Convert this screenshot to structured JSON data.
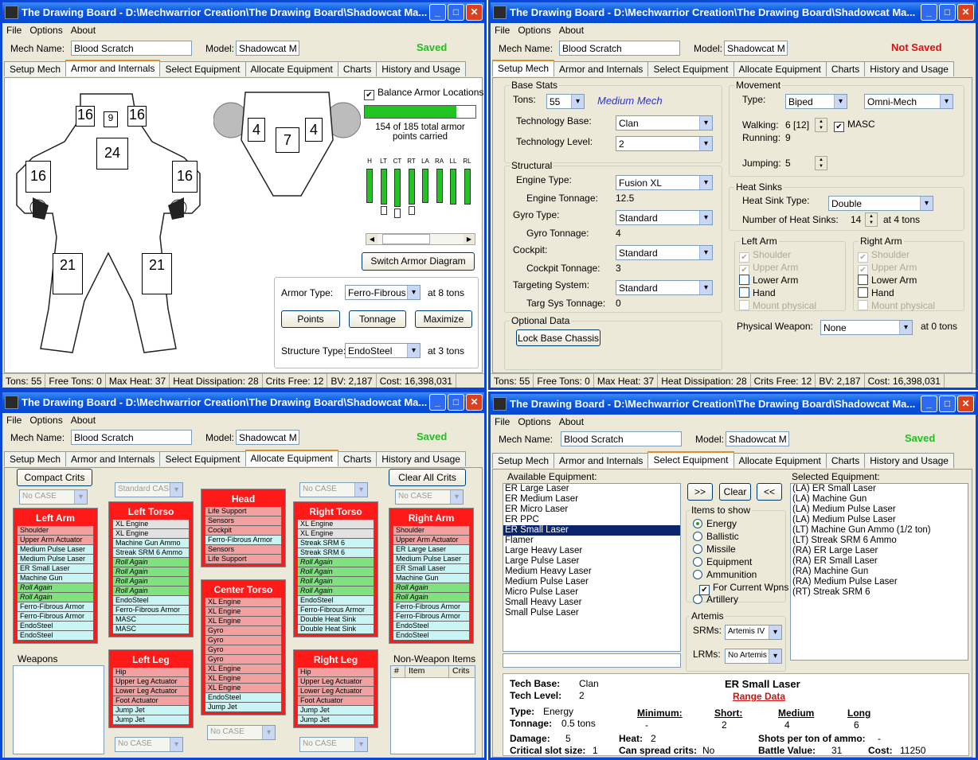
{
  "app": {
    "title": "The Drawing Board - D:\\Mechwarrior Creation\\The Drawing Board\\Shadowcat Ma...",
    "menu": [
      "File",
      "Options",
      "About"
    ],
    "tabs": [
      "Setup Mech",
      "Armor and Internals",
      "Select Equipment",
      "Allocate Equipment",
      "Charts",
      "History and Usage"
    ],
    "mech_name_label": "Mech Name:",
    "mech_name": "Blood Scratch",
    "model_label": "Model:",
    "model": "Shadowcat M",
    "saved": "Saved",
    "not_saved": "Not Saved"
  },
  "status": [
    "Tons: 55",
    "Free Tons: 0",
    "Max Heat: 37",
    "Heat Dissipation: 28",
    "Crits Free: 12",
    "BV: 2,187",
    "Cost: 16,398,031"
  ],
  "armor": {
    "rear": {
      "lt": "4",
      "ct": "7",
      "rt": "4"
    },
    "front": {
      "hd": "9",
      "ltu": "16",
      "rtu": "16",
      "ct": "24",
      "la": "16",
      "ra": "16",
      "ll": "21",
      "rl": "21"
    },
    "balance_label": "Balance Armor Locations",
    "progress": 0.83,
    "points_text": "154 of 185 total armor points carried",
    "bar_labels": [
      "H",
      "LT",
      "CT",
      "RT",
      "LA",
      "RA",
      "LL",
      "RL"
    ],
    "bars": [
      {
        "front": 0.85,
        "rear": 0
      },
      {
        "front": 0.9,
        "rear": 0.35
      },
      {
        "front": 0.95,
        "rear": 0.4
      },
      {
        "front": 0.9,
        "rear": 0.35
      },
      {
        "front": 0.85,
        "rear": 0
      },
      {
        "front": 0.85,
        "rear": 0
      },
      {
        "front": 0.9,
        "rear": 0
      },
      {
        "front": 0.9,
        "rear": 0
      }
    ],
    "switch_btn": "Switch Armor Diagram",
    "armor_type_label": "Armor Type:",
    "armor_type": "Ferro-Fibrous",
    "armor_tons": "at 8 tons",
    "points_btn": "Points",
    "tonnage_btn": "Tonnage",
    "maximize_btn": "Maximize",
    "structure_label": "Structure Type:",
    "structure": "EndoSteel",
    "structure_tons": "at 3 tons"
  },
  "setup": {
    "base_stats": "Base Stats",
    "tons_label": "Tons:",
    "tons": "55",
    "weight_class": "Medium Mech",
    "tech_base_label": "Technology Base:",
    "tech_base": "Clan",
    "tech_level_label": "Technology Level:",
    "tech_level": "2",
    "structural": "Structural",
    "engine_type_label": "Engine Type:",
    "engine_type": "Fusion XL",
    "engine_tonnage_label": "Engine Tonnage:",
    "engine_tonnage": "12.5",
    "gyro_label": "Gyro Type:",
    "gyro": "Standard",
    "gyro_tonnage_label": "Gyro Tonnage:",
    "gyro_tonnage": "4",
    "cockpit_label": "Cockpit:",
    "cockpit": "Standard",
    "cockpit_tonnage_label": "Cockpit Tonnage:",
    "cockpit_tonnage": "3",
    "targeting_label": "Targeting System:",
    "targeting": "Standard",
    "targ_tonnage_label": "Targ Sys Tonnage:",
    "targ_tonnage": "0",
    "optional": "Optional Data",
    "lock_btn": "Lock Base Chassis",
    "movement": "Movement",
    "type_label": "Type:",
    "type": "Biped",
    "omni": "Omni-Mech",
    "walking_label": "Walking:",
    "walking": "6 [12]",
    "masc": "MASC",
    "running_label": "Running:",
    "running": "9",
    "jumping_label": "Jumping:",
    "jumping": "5",
    "heat_sinks": "Heat Sinks",
    "hs_type_label": "Heat Sink Type:",
    "hs_type": "Double",
    "hs_num_label": "Number of Heat Sinks:",
    "hs_num": "14",
    "hs_tons": "at 4 tons",
    "left_arm": "Left Arm",
    "right_arm": "Right Arm",
    "arm_items": [
      "Shoulder",
      "Upper Arm",
      "Lower Arm",
      "Hand",
      "Mount physical"
    ],
    "physical_label": "Physical Weapon:",
    "physical": "None",
    "physical_tons": "at 0 tons"
  },
  "alloc": {
    "compact_btn": "Compact Crits",
    "clear_btn": "Clear All Crits",
    "no_case": "No CASE",
    "standard_case": "Standard CASE",
    "weapons": "Weapons",
    "nonweapon": "Non-Weapon Items",
    "col_num": "#",
    "col_item": "Item",
    "col_crits": "Crits",
    "locations": {
      "left_arm": {
        "title": "Left Arm",
        "slots": [
          "Shoulder",
          "Upper Arm Actuator",
          "Medium Pulse Laser",
          "Medium Pulse Laser",
          "ER Small Laser",
          "Machine Gun",
          "Roll Again",
          "Roll Again",
          "Ferro-Fibrous Armor",
          "Ferro-Fibrous Armor",
          "EndoSteel",
          "EndoSteel"
        ]
      },
      "left_torso": {
        "title": "Left Torso",
        "slots": [
          "XL Engine",
          "XL Engine",
          "Machine Gun Ammo",
          "Streak SRM 6 Ammo",
          "Roll Again",
          "Roll Again",
          "Roll Again",
          "Roll Again",
          "EndoSteel",
          "Ferro-Fibrous Armor",
          "MASC",
          "MASC"
        ]
      },
      "head": {
        "title": "Head",
        "slots": [
          "Life Support",
          "Sensors",
          "Cockpit",
          "Ferro-Fibrous Armor",
          "Sensors",
          "Life Support"
        ]
      },
      "center_torso": {
        "title": "Center Torso",
        "slots": [
          "XL Engine",
          "XL Engine",
          "XL Engine",
          "Gyro",
          "Gyro",
          "Gyro",
          "Gyro",
          "XL Engine",
          "XL Engine",
          "XL Engine",
          "EndoSteel",
          "Jump Jet"
        ]
      },
      "right_torso": {
        "title": "Right Torso",
        "slots": [
          "XL Engine",
          "XL Engine",
          "Streak SRM 6",
          "Streak SRM 6",
          "Roll Again",
          "Roll Again",
          "Roll Again",
          "Roll Again",
          "EndoSteel",
          "Ferro-Fibrous Armor",
          "Double Heat Sink",
          "Double Heat Sink"
        ]
      },
      "right_arm": {
        "title": "Right Arm",
        "slots": [
          "Shoulder",
          "Upper Arm Actuator",
          "ER Large Laser",
          "Medium Pulse Laser",
          "ER Small Laser",
          "Machine Gun",
          "Roll Again",
          "Roll Again",
          "Ferro-Fibrous Armor",
          "Ferro-Fibrous Armor",
          "EndoSteel",
          "EndoSteel"
        ]
      },
      "left_leg": {
        "title": "Left Leg",
        "slots": [
          "Hip",
          "Upper Leg Actuator",
          "Lower Leg Actuator",
          "Foot Actuator",
          "Jump Jet",
          "Jump Jet"
        ]
      },
      "right_leg": {
        "title": "Right Leg",
        "slots": [
          "Hip",
          "Upper Leg Actuator",
          "Lower Leg Actuator",
          "Foot Actuator",
          "Jump Jet",
          "Jump Jet"
        ]
      }
    }
  },
  "select": {
    "available_label": "Available Equipment:",
    "selected_label": "Selected Equipment:",
    "available": [
      "ER Large Laser",
      "ER Medium Laser",
      "ER Micro Laser",
      "ER PPC",
      "ER Small Laser",
      "Flamer",
      "Large Heavy Laser",
      "Large Pulse Laser",
      "Medium Heavy Laser",
      "Medium Pulse Laser",
      "Micro Pulse Laser",
      "Small Heavy Laser",
      "Small Pulse Laser"
    ],
    "selected_index": 4,
    "selected": [
      "(LA) ER Small Laser",
      "(LA) Machine Gun",
      "(LA) Medium Pulse Laser",
      "(LA) Medium Pulse Laser",
      "(LT) Machine Gun Ammo (1/2 ton)",
      "(LT) Streak SRM 6 Ammo",
      "(RA) ER Large Laser",
      "(RA) ER Small Laser",
      "(RA) Machine Gun",
      "(RA) Medium Pulse Laser",
      "(RT) Streak SRM 6"
    ],
    "add_all": ">>",
    "clear": "Clear",
    "remove": "<<",
    "items_to_show": "Items to show",
    "filters": [
      "Energy",
      "Ballistic",
      "Missile",
      "Equipment",
      "Ammunition"
    ],
    "for_current": "For Current Wpns",
    "artillery": "Artillery",
    "artemis": "Artemis",
    "srms_label": "SRMs:",
    "srms": "Artemis IV",
    "lrms_label": "LRMs:",
    "lrms": "No Artemis",
    "info": {
      "tech_base_label": "Tech Base:",
      "tech_base": "Clan",
      "tech_level_label": "Tech Level:",
      "tech_level": "2",
      "name": "ER Small Laser",
      "range_data": "Range Data",
      "type_label": "Type:",
      "type": "Energy",
      "tonnage_label": "Tonnage:",
      "tonnage": "0.5 tons",
      "min_label": "Minimum:",
      "short_label": "Short:",
      "medium_label": "Medium",
      "long_label": "Long",
      "min": "-",
      "short": "2",
      "medium": "4",
      "long": "6",
      "damage_label": "Damage:",
      "damage": "5",
      "heat_label": "Heat:",
      "heat": "2",
      "shots_label": "Shots per ton of ammo:",
      "shots": "-",
      "crit_label": "Critical slot size:",
      "crit": "1",
      "spread_label": "Can spread crits:",
      "spread": "No",
      "bv_label": "Battle Value:",
      "bv": "31",
      "cost_label": "Cost:",
      "cost": "11250"
    }
  }
}
